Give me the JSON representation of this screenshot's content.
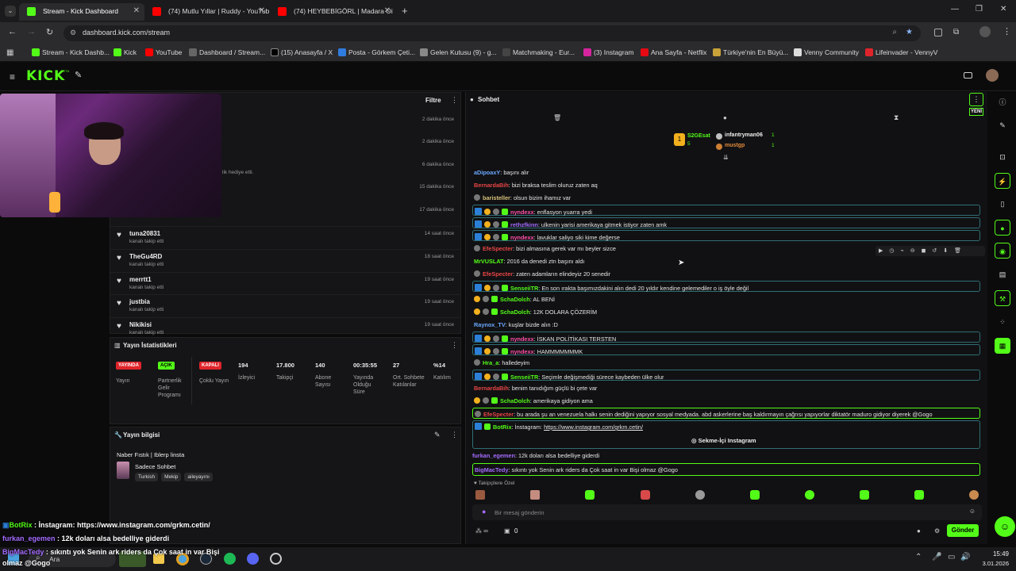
{
  "browser": {
    "tabs": [
      {
        "label": "Stream - Kick Dashboard",
        "color": "#53fc18"
      },
      {
        "label": "(74) Mutlu Yıllar | Ruddy - YouTub",
        "color": "#ff0000"
      },
      {
        "label": "(74) HEYBEBİGÖRL | Madara Oi",
        "color": "#ff0000"
      }
    ],
    "url": "dashboard.kick.com/stream",
    "bookmarks": [
      "Stream - Kick Dashb...",
      "Kick",
      "YouTube",
      "Dashboard / Stream...",
      "(15) Anasayfa / X",
      "Posta - Görkem Çeti...",
      "Gelen Kutusu (9) - g...",
      "Matchmaking - Eur...",
      "(3) Instagram",
      "Ana Sayfa - Netflix",
      "Türkiye'nin En Büyü...",
      "Venny Community",
      "Lifeinvader - VennyV"
    ]
  },
  "kick": {
    "logo": "KICK",
    "beta": "BETA"
  },
  "activity": {
    "filter_label": "Filtre",
    "partial_text": "lik hediye etti.",
    "partial_rows": [
      {
        "time": "2 dakika önce"
      },
      {
        "time": "2 dakika önce"
      },
      {
        "time": "6 dakika önce"
      },
      {
        "time": "15 dakika önce"
      },
      {
        "time": "17 dakika önce"
      }
    ],
    "items": [
      {
        "name": "tuna20831",
        "sub": "kanalı takip etti",
        "time": "14 saat önce"
      },
      {
        "name": "TheGu4RD",
        "sub": "kanalı takip etti",
        "time": "18 saat önce"
      },
      {
        "name": "merrtt1",
        "sub": "kanalı takip etti",
        "time": "19 saat önce"
      },
      {
        "name": "justbia",
        "sub": "kanalı takip etti",
        "time": "19 saat önce"
      },
      {
        "name": "Nikikisi",
        "sub": "kanalı takip etti",
        "time": "19 saat önce"
      }
    ]
  },
  "stats": {
    "title": "Yayın İstatistikleri",
    "items": [
      {
        "badge": "YAYINDA",
        "label": "Yayın",
        "badge_color": "#e0242b"
      },
      {
        "badge": "AÇIK",
        "label": "Partnerlik Gelir Programı",
        "badge_color": "#53fc18"
      },
      {
        "badge": "KAPALI",
        "label": "Çoklu Yayın",
        "badge_color": "#e0242b"
      }
    ],
    "metrics": [
      {
        "value": "194",
        "label": "İzleyici"
      },
      {
        "value": "17.800",
        "label": "Takipçi"
      },
      {
        "value": "140",
        "label": "Abone Sayısı"
      },
      {
        "value": "00:35:55",
        "label": "Yayında Olduğu Süre"
      },
      {
        "value": "27",
        "label": "Ort. Sohbete Katılanlar"
      },
      {
        "value": "%14",
        "label": "Katılım"
      }
    ]
  },
  "stream_info": {
    "title": "Yayın bilgisi",
    "stream_title": "Naber Fıstık | Iblerp linsta",
    "category": "Sadece Sohbet",
    "tags": [
      "Turkish",
      "Mekip",
      "aileyayını"
    ]
  },
  "chat": {
    "title": "Sohbet",
    "new_label": "YENİ",
    "leaderboard": [
      {
        "name": "S2GEsat",
        "count": "5"
      },
      {
        "name": "infantryman06",
        "count": "1"
      },
      {
        "name": "mustgp",
        "count": "1"
      }
    ],
    "messages": [
      {
        "user": "aDipoaxY",
        "color": "#6aa8ff",
        "text": ": başını alır",
        "style": "plain",
        "badges": ""
      },
      {
        "user": "BernardaBih",
        "color": "#e84545",
        "text": ": bizi braksa teslim oluruz zaten aq",
        "style": "plain",
        "badges": ""
      },
      {
        "user": "baristeller",
        "color": "#d8c27a",
        "text": ": olsun bizim ihamız var",
        "style": "plain",
        "badges": "b"
      },
      {
        "user": "nyndexx",
        "color": "#ff4fa8",
        "text": ": enflasyon yuarra yedi",
        "style": "boxed",
        "badges": "mod"
      },
      {
        "user": "rethzfkinn",
        "color": "#a46cff",
        "text": ": ulkenin yarisi amerikaya gitmek istiyor zaten amk",
        "style": "boxed",
        "badges": "mod"
      },
      {
        "user": "nyndexx",
        "color": "#ff4fa8",
        "text": ": lavuklar saliyo siki kime değerse",
        "style": "boxed",
        "badges": "mod"
      },
      {
        "user": "EfeSpecter",
        "color": "#e84545",
        "text": ": bizi almasına gerek var mı beyler sizce",
        "style": "plain",
        "badges": "b"
      },
      {
        "user": "MrVUSLAT",
        "color": "#53fc18",
        "text": ": 2016 da denedi ztn başını aldı",
        "style": "plain",
        "badges": ""
      },
      {
        "user": "EfeSpecter",
        "color": "#e84545",
        "text": ": zaten adamların elindeyiz 20 senedir",
        "style": "plain",
        "badges": "b"
      },
      {
        "user": "SenseiiTR",
        "color": "#53fc18",
        "text": ": En son ıraktа başımızdakini alın dedi 20 yıldır kendine gelemediler o iş öyle değil",
        "style": "boxed",
        "badges": "mod"
      },
      {
        "user": "SchaDolch",
        "color": "#53fc18",
        "text": ": AL BENİ",
        "style": "plain",
        "badges": "g"
      },
      {
        "user": "SchaDolch",
        "color": "#53fc18",
        "text": ": 12K DOLARA ÇÖZERİM",
        "style": "plain",
        "badges": "g"
      },
      {
        "user": "Raynox_TV",
        "color": "#6aa8ff",
        "text": ": kuşlar bizde alın :D",
        "style": "plain",
        "badges": ""
      },
      {
        "user": "nyndexx",
        "color": "#ff4fa8",
        "text": ": İSKAN POLİTİKASI TERSTEN",
        "style": "boxed",
        "badges": "mod"
      },
      {
        "user": "nyndexx",
        "color": "#ff4fa8",
        "text": ": HAMMMMMMMK",
        "style": "boxed",
        "badges": "mod"
      },
      {
        "user": "Hra_a",
        "color": "#53fc18",
        "text": ": halledeyim",
        "style": "plain",
        "badges": "b"
      },
      {
        "user": "SenseiiTR",
        "color": "#53fc18",
        "text": ": Seçimle değişmediği sürece kaybeden ülke olur",
        "style": "boxed",
        "badges": "mod"
      },
      {
        "user": "BernardaBih",
        "color": "#e84545",
        "text": ": benim tanıdığım güçlü bi çete var",
        "style": "plain",
        "badges": ""
      },
      {
        "user": "SchaDolch",
        "color": "#53fc18",
        "text": ": amerikaya gidiyon ama",
        "style": "plain",
        "badges": "g"
      },
      {
        "user": "EfeSpecter",
        "color": "#e84545",
        "text": ": bu arada şu an venezuela halkı senin dediğini yapıyor sosyal medyada. abd askerlerine baş kaldırmayın çağrısı yapıyorlar diktatör maduro gidiyor diyerek @Gogo",
        "style": "green",
        "badges": "b"
      }
    ],
    "botrix_user": "BotRix",
    "botrix_text": ": İnstagram: ",
    "botrix_link": "https://www.instagram.com/grkm.cetin/",
    "botrix_button": "Sekme-İçi Instagram",
    "tail_messages": [
      {
        "user": "furkan_egemen",
        "color": "#a46cff",
        "text": ": 12k doları alsa bedelliye giderdi"
      },
      {
        "user": "BigMacTedy",
        "color": "#a46cff",
        "text": ": sıkıntı yok Senin ark riders da Çok saat in var Bişi olmaz @Gogo"
      }
    ],
    "emote_label": "Takipçilere Özel",
    "input_placeholder": "Bir mesaj gönderin",
    "points": "0",
    "send_label": "Gönder"
  },
  "overlay": {
    "line1_user": "BotRix",
    "line1_text": " : İnstagram: https://www.instagram.com/grkm.cetin/",
    "line2_user": "furkan_egemen",
    "line2_text": " : 12k doları alsa bedelliye giderdi",
    "line3_user": "BigMacTedy",
    "line3_text": " : sıkıntı yok Senin ark riders da Çok saat in var Bişi",
    "line4_text": "olmaz @Gogo"
  },
  "taskbar": {
    "search": "Ara",
    "time": "15:49",
    "date": "3.01.2026"
  }
}
